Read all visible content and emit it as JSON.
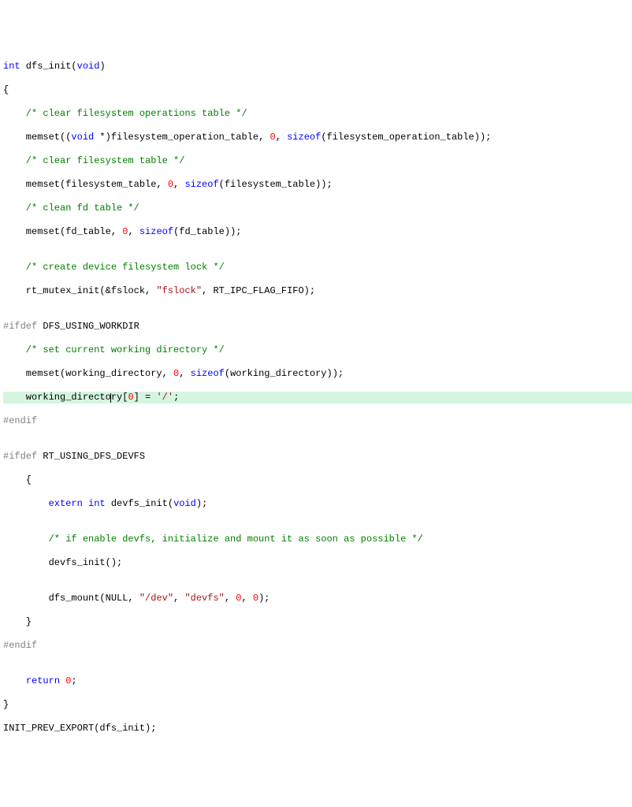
{
  "code": {
    "l1": {
      "kw1": "int",
      "fn": " dfs_init(",
      "kw2": "void",
      "p": ")"
    },
    "l2": "{",
    "l3": "    /* clear filesystem operations table */",
    "l4": {
      "pre": "    memset((",
      "kw1": "void",
      "mid": " *)filesystem_operation_table, ",
      "n": "0",
      "mid2": ", ",
      "kw2": "sizeof",
      "post": "(filesystem_operation_table));"
    },
    "l5": "    /* clear filesystem table */",
    "l6": {
      "pre": "    memset(filesystem_table, ",
      "n": "0",
      "mid": ", ",
      "kw": "sizeof",
      "post": "(filesystem_table));"
    },
    "l7": "    /* clean fd table */",
    "l8": {
      "pre": "    memset(fd_table, ",
      "n": "0",
      "mid": ", ",
      "kw": "sizeof",
      "post": "(fd_table));"
    },
    "l9": "",
    "l10": "    /* create device filesystem lock */",
    "l11": {
      "pre": "    rt_mutex_init(&fslock, ",
      "s": "\"fslock\"",
      "post": ", RT_IPC_FLAG_FIFO);"
    },
    "l12": "",
    "l13a": "#ifdef",
    "l13b": " DFS_USING_WORKDIR",
    "l14": "    /* set current working directory */",
    "l15": {
      "pre": "    memset(working_directory, ",
      "n": "0",
      "mid": ", ",
      "kw": "sizeof",
      "post": "(working_directory));"
    },
    "l16": {
      "pre": "    working_directo",
      "caret": "",
      "mid": "ry[",
      "n": "0",
      "mid2": "] = ",
      "s": "'/'",
      "post": ";"
    },
    "l17": "#endif",
    "l18": "",
    "l19a": "#ifdef",
    "l19b": " RT_USING_DFS_DEVFS",
    "l20": "    {",
    "l21": {
      "pre": "        ",
      "kw1": "extern",
      "sp": " ",
      "kw2": "int",
      "mid": " devfs_init(",
      "kw3": "void",
      "post": ");"
    },
    "l22": "",
    "l23": "        /* if enable devfs, initialize and mount it as soon as possible */",
    "l24": "        devfs_init();",
    "l25": "",
    "l26": {
      "pre": "        dfs_mount(NULL, ",
      "s1": "\"/dev\"",
      "mid": ", ",
      "s2": "\"devfs\"",
      "mid2": ", ",
      "n1": "0",
      "mid3": ", ",
      "n2": "0",
      "post": ");"
    },
    "l27": "    }",
    "l28": "#endif",
    "l29": "",
    "l30": {
      "pre": "    ",
      "kw": "return",
      "sp": " ",
      "n": "0",
      "post": ";"
    },
    "l31": "}",
    "l32": "INIT_PREV_EXPORT(dfs_init);"
  }
}
